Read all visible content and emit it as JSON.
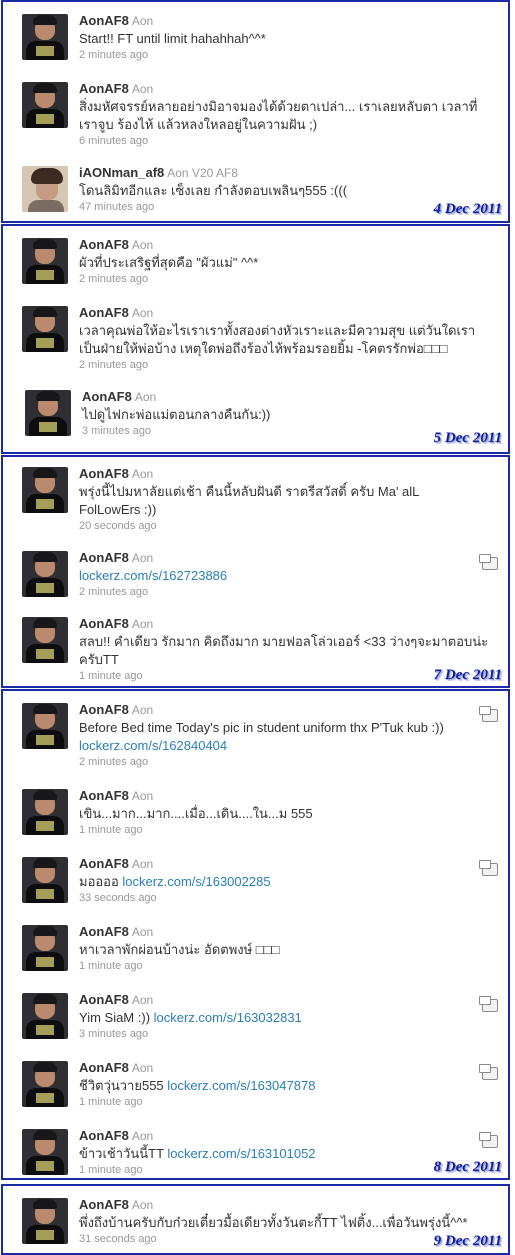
{
  "panels": [
    {
      "date": "4 Dec 2011",
      "tweets": [
        {
          "user": "AonAF8",
          "real": "Aon",
          "l1": "Start!! FT until limit hahahhah^^*",
          "time": "2 minutes ago"
        },
        {
          "user": "AonAF8",
          "real": "Aon",
          "l1": "สิ่งมหัศจรรย์หลายอย่างมิอาจมองได้ด้วยตาเปล่า... เราเลยหลับตา เวลาที่",
          "l2": "เราจูบ ร้องไห้ แล้วหลงใหลอยู่ในความฝัน ;)",
          "time": "6 minutes ago"
        },
        {
          "user": "iAONman_af8",
          "real": "Aon V20 AF8",
          "l1": "โดนลิมิทอีกและ เซ็งเลย กำลังตอบเพลินๆ555 :(((",
          "time": "47 minutes ago"
        }
      ]
    },
    {
      "date": "5 Dec 2011",
      "tweets": [
        {
          "user": "AonAF8",
          "real": "Aon",
          "l1": "ผัวที่ประเสริฐที่สุดคือ \"ผัวแม่\" ^^*",
          "time": "2 minutes ago"
        },
        {
          "user": "AonAF8",
          "real": "Aon",
          "l1": "เวลาคุณพ่อให้อะไรเราเราทั้งสองต่างหัวเราะและมีความสุข แต่วันใดเรา",
          "l2": "เป็นฝ่ายให้พ่อบ้าง เหตุใดพ่อถึงร้องไห้พร้อมรอยยิ้ม -โคตรรักพ่อ□□□",
          "time": "2 minutes ago"
        },
        {
          "user": "AonAF8",
          "real": "Aon",
          "l1": "ไปดูไฟกะพ่อแม่ตอนกลางคืนกัน:))",
          "time": "3 minutes ago"
        }
      ]
    },
    {
      "date": "7 Dec 2011",
      "tweets": [
        {
          "user": "AonAF8",
          "real": "Aon",
          "l1": "พรุ่งนี้ไปมหาลัยแต่เช้า คืนนี้หลับฝันดี ราตรีสวัสดิ์ ครับ Ma' alL",
          "l2": "FolLowErs :))",
          "time": "20 seconds ago"
        },
        {
          "user": "AonAF8",
          "real": "Aon",
          "l1": "",
          "link1": "lockerz.com/s/162723886",
          "time": "2 minutes ago"
        },
        {
          "user": "AonAF8",
          "real": "Aon",
          "l1": "สลบ!! คำเดียว รักมาก คิดถึงมาก มายฟอลโล่วเออร์ <33 ว่างๆจะมาตอบน่ะ",
          "l2": "ครับTT",
          "time": "1 minute ago"
        }
      ]
    },
    {
      "date": "8 Dec 2011",
      "tweets": [
        {
          "user": "AonAF8",
          "real": "Aon",
          "l1": "Before Bed time Today's pic in student uniform thx P'Tuk kub :))",
          "link2": "lockerz.com/s/162840404",
          "time": "2 minutes ago"
        },
        {
          "user": "AonAF8",
          "real": "Aon",
          "l1": "เขิน...มาก...มาก....เมื่อ...เดิน....ใน...ม 555",
          "time": "1 minute ago"
        },
        {
          "user": "AonAF8",
          "real": "Aon",
          "l1": "มออออ ",
          "link1": "lockerz.com/s/163002285",
          "time": "33 seconds ago"
        },
        {
          "user": "AonAF8",
          "real": "Aon",
          "l1": "หาเวลาพักผ่อนบ้างน่ะ อัดตพงษ์ □□□",
          "time": "1 minute ago"
        },
        {
          "user": "AonAF8",
          "real": "Aon",
          "l1": "Yim SiaM :)) ",
          "link1": "lockerz.com/s/163032831",
          "time": "3 minutes ago"
        },
        {
          "user": "AonAF8",
          "real": "Aon",
          "l1": "ชีวิตวุ่นวาย555 ",
          "link1": "lockerz.com/s/163047878",
          "time": "1 minute ago"
        },
        {
          "user": "AonAF8",
          "real": "Aon",
          "l1": "ข้าวเช้าวันนี้TT ",
          "link1": "lockerz.com/s/163101052",
          "time": "1 minute ago"
        }
      ]
    },
    {
      "date": "9 Dec 2011",
      "tweets": [
        {
          "user": "AonAF8",
          "real": "Aon",
          "l1": "พึ่งถึงบ้านครับกับก๋วยเตี๋ยวมื้อเดียวทั้งวันตะกี้TT ไฟติ้ง...เพื่อวันพรุ่งนี้^^*",
          "time": "31 seconds ago"
        }
      ]
    }
  ]
}
